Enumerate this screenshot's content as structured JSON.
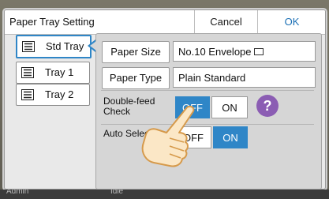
{
  "dialog": {
    "title": "Paper Tray Setting",
    "cancel_label": "Cancel",
    "ok_label": "OK"
  },
  "trays": [
    {
      "label": "Std Tray",
      "selected": true,
      "icon": "tray-lines-icon"
    },
    {
      "label": "Tray 1",
      "selected": false,
      "icon": "tray-lines-icon"
    },
    {
      "label": "Tray 2",
      "selected": false,
      "icon": "tray-lines-icon"
    }
  ],
  "settings": {
    "paper_size_label": "Paper Size",
    "paper_size_value": "No.10 Envelope",
    "paper_type_label": "Paper Type",
    "paper_type_value": "Plain Standard",
    "double_feed_label_1": "Double-feed",
    "double_feed_label_2": "Check",
    "double_feed_off": "OFF",
    "double_feed_on": "ON",
    "double_feed_state": "OFF",
    "auto_selection_label": "Auto Selecti",
    "auto_off": "OFF",
    "auto_on": "ON",
    "auto_state": "ON",
    "help_label": "?"
  },
  "statusbar": {
    "user": "Admin",
    "state": "Idle"
  },
  "colors": {
    "accent": "#2f86c7",
    "help": "#8b5db3"
  }
}
